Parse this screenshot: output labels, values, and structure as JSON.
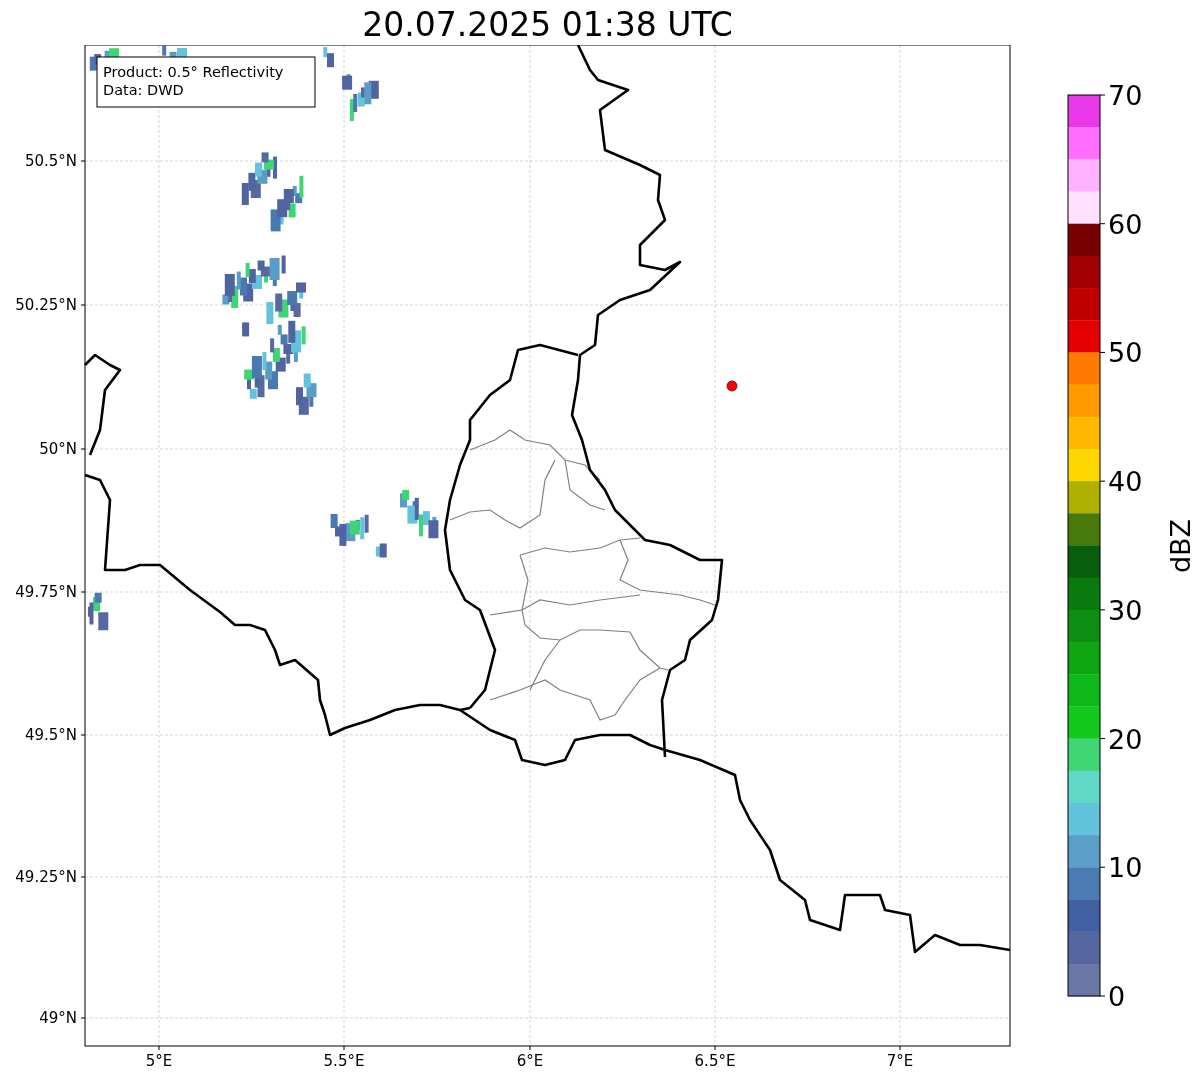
{
  "title": "20.07.2025 01:38 UTC",
  "legend": {
    "lines": [
      "Product: 0.5° Reflectivity",
      "Data: DWD"
    ]
  },
  "x_ticks": [
    {
      "label": "5°E"
    },
    {
      "label": "5.5°E"
    },
    {
      "label": "6°E"
    },
    {
      "label": "6.5°E"
    },
    {
      "label": "7°E"
    }
  ],
  "y_ticks": [
    {
      "label": "50.5°N"
    },
    {
      "label": "50.25°N"
    },
    {
      "label": "50°N"
    },
    {
      "label": "49.75°N"
    },
    {
      "label": "49.5°N"
    },
    {
      "label": "49.25°N"
    },
    {
      "label": "49°N"
    }
  ],
  "colorbar": {
    "label": "dBZ",
    "ticks": [
      "70",
      "60",
      "50",
      "40",
      "30",
      "20",
      "10",
      "0"
    ],
    "bands": [
      {
        "color": "#e838e8"
      },
      {
        "color": "#ff6eff"
      },
      {
        "color": "#ffb2ff"
      },
      {
        "color": "#ffe0ff"
      },
      {
        "color": "#780000"
      },
      {
        "color": "#a00000"
      },
      {
        "color": "#c00000"
      },
      {
        "color": "#e40000"
      },
      {
        "color": "#ff7a00"
      },
      {
        "color": "#ff9a00"
      },
      {
        "color": "#ffb800"
      },
      {
        "color": "#ffd700"
      },
      {
        "color": "#b0b000"
      },
      {
        "color": "#477a0a"
      },
      {
        "color": "#075f0b"
      },
      {
        "color": "#0a7a10"
      },
      {
        "color": "#0c8f12"
      },
      {
        "color": "#0ea512"
      },
      {
        "color": "#0fb81a"
      },
      {
        "color": "#12c81a"
      },
      {
        "color": "#3ed672"
      },
      {
        "color": "#5fd9c6"
      },
      {
        "color": "#63c2dc"
      },
      {
        "color": "#5b9fc8"
      },
      {
        "color": "#4a7cb3"
      },
      {
        "color": "#4360a3"
      },
      {
        "color": "#56669f"
      },
      {
        "color": "#6a78a8"
      }
    ]
  }
}
